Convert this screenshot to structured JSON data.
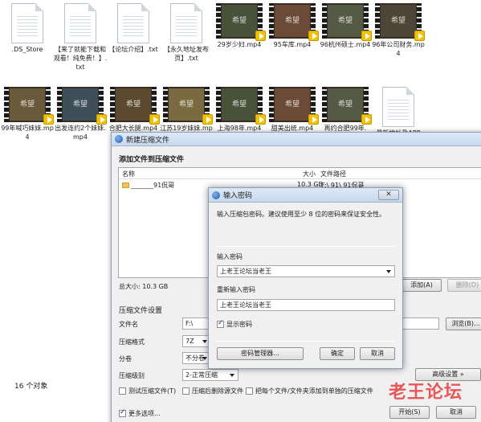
{
  "explorer": {
    "files_row1": [
      {
        "name": ".DS_Store",
        "type": "doc"
      },
      {
        "name": "【来了就能下载和观看！纯免费！】.txt",
        "type": "doc"
      },
      {
        "name": "【论坛介绍】.txt",
        "type": "doc"
      },
      {
        "name": "【永久地址发布页】.txt",
        "type": "doc"
      },
      {
        "name": "29岁少妇.mp4",
        "type": "video"
      },
      {
        "name": "95车库.mp4",
        "type": "video"
      },
      {
        "name": "96杭州硕士.mp4",
        "type": "video"
      },
      {
        "name": "96年公司财务.mp4",
        "type": "video"
      }
    ],
    "files_row2": [
      {
        "name": "99年喊巧妹妹.mp4",
        "type": "video"
      },
      {
        "name": "出发连约2个妹妹.mp4",
        "type": "video"
      },
      {
        "name": "合肥大长腿.mp4",
        "type": "video"
      },
      {
        "name": "江苏19岁妹妹.mp4",
        "type": "video"
      },
      {
        "name": "上海98年.mp4",
        "type": "video"
      },
      {
        "name": "甜美出统.mp4",
        "type": "video"
      },
      {
        "name": "再约合肥99年.",
        "type": "video"
      },
      {
        "name": "最新地址及APP",
        "type": "doc"
      }
    ],
    "video_watermark": "希望",
    "status_count": "16 个对象"
  },
  "archive_window": {
    "title": "新建压缩文件",
    "section_add": "添加文件到压缩文件",
    "columns": {
      "name": "名称",
      "size": "大小",
      "path": "文件路径"
    },
    "rows": [
      {
        "name": "_______91侃哥",
        "size": "10.3 GB",
        "path": "F:\\        91\\        91侃哥"
      }
    ],
    "total_size": "总大小: 10.3 GB",
    "add_button": "添加(A)",
    "delete_button": "删除(D)",
    "settings_title": "压缩文件设置",
    "filename_label": "文件名",
    "filename_value": "F:\\",
    "browse_button": "浏览(B)...",
    "format_label": "压缩格式",
    "format_value": "7Z",
    "volume_label": "分卷",
    "volume_value": "不分卷",
    "level_label": "压缩级别",
    "level_value": "2-正常压缩",
    "advanced_button": "高级设置 »",
    "opt_test": "测试压缩文件(T)",
    "opt_delete_src": "压缩后删除源文件",
    "opt_each_separate": "把每个文件/文件夹添加到单独的压缩文件",
    "more_options": "更多选项...",
    "start_button": "开始(S)",
    "cancel_button": "取消"
  },
  "password_dialog": {
    "title": "输入密码",
    "hint": "输入压缩包密码。建议使用至少 8 位的密码来保证安全性。",
    "enter_label": "输入密码",
    "enter_value": "上老王论坛当老王",
    "reenter_label": "重新输入密码",
    "reenter_value": "上老王论坛当老王",
    "show_password": "显示密码",
    "manager_button": "密码管理器...",
    "ok_button": "确定",
    "cancel_button": "取消"
  },
  "watermark": "老王论坛"
}
